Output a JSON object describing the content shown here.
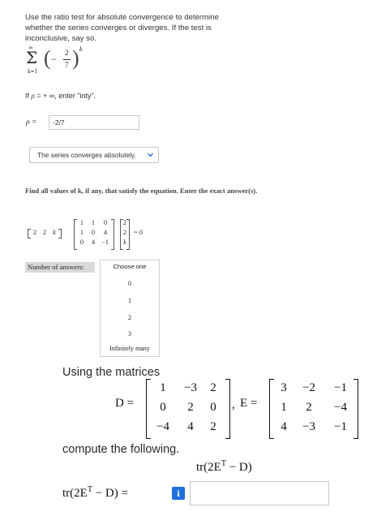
{
  "problem1": {
    "instructions": "Use the ratio test for absolute convergence to determine whether the series converges or diverges. If the test is inconclusive, say so.",
    "series": {
      "upper": "∞",
      "sigma": "Σ",
      "lower": "k=1",
      "open": "(",
      "sign": "−",
      "numerator": "2",
      "denominator": "7",
      "close": ")",
      "exponent": "k"
    },
    "note_pre": "If ",
    "note_rho": "ρ",
    "note_mid": " = + ∞, enter \"inty\".",
    "rho_label": "ρ =",
    "rho_value": "-2/7",
    "conclusion": "The series converges absolutely."
  },
  "problem2": {
    "instructions": "Find all values of k, if any, that satisfy the equation. Enter the exact answer(s).",
    "row_vector": [
      "2",
      "2",
      "k"
    ],
    "matrix": [
      [
        "1",
        "1",
        "0"
      ],
      [
        "1",
        "0",
        "4"
      ],
      [
        "0",
        "4",
        "−1"
      ]
    ],
    "column_vector": [
      "2",
      "2",
      "k"
    ],
    "equals": "= 0",
    "number_label": "Number of answers:",
    "choose_label": "Choose one",
    "options": [
      "0",
      "1",
      "2",
      "3",
      "Infinitely many"
    ]
  },
  "problem3": {
    "intro": "Using the matrices",
    "D_label": "D =",
    "D": [
      [
        "1",
        "−3",
        "2"
      ],
      [
        "0",
        "2",
        "0"
      ],
      [
        "−4",
        "4",
        "2"
      ]
    ],
    "comma": ",",
    "E_label": "E =",
    "E": [
      [
        "3",
        "−2",
        "−1"
      ],
      [
        "1",
        "2",
        "−4"
      ],
      [
        "4",
        "−3",
        "−1"
      ]
    ],
    "compute": "compute the following.",
    "expression": "tr(2E",
    "expr_sup": "T",
    "expr_tail": " − D)",
    "answer_label": "tr(2E",
    "answer_sup": "T",
    "answer_tail": " − D) =",
    "info_icon": "i",
    "answer_value": ""
  }
}
